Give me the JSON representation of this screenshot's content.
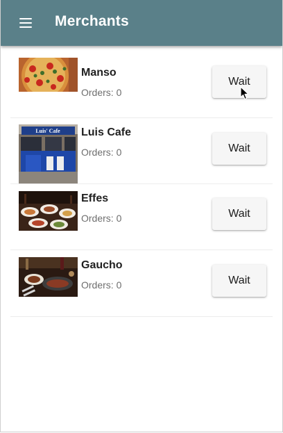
{
  "app_bar": {
    "title": "Merchants",
    "menu_icon": "hamburger-menu-icon",
    "background_color": "#5a8089"
  },
  "merchants": [
    {
      "name": "Manso",
      "orders_label": "Orders: 0",
      "button_label": "Wait",
      "image": "pizza-photo"
    },
    {
      "name": "Luis Cafe",
      "orders_label": "Orders: 0",
      "button_label": "Wait",
      "image": "cafe-storefront-photo",
      "image_sign_text": "Luis' Cafe"
    },
    {
      "name": "Effes",
      "orders_label": "Orders: 0",
      "button_label": "Wait",
      "image": "restaurant-dishes-photo"
    },
    {
      "name": "Gaucho",
      "orders_label": "Orders: 0",
      "button_label": "Wait",
      "image": "steak-dinner-photo"
    }
  ]
}
